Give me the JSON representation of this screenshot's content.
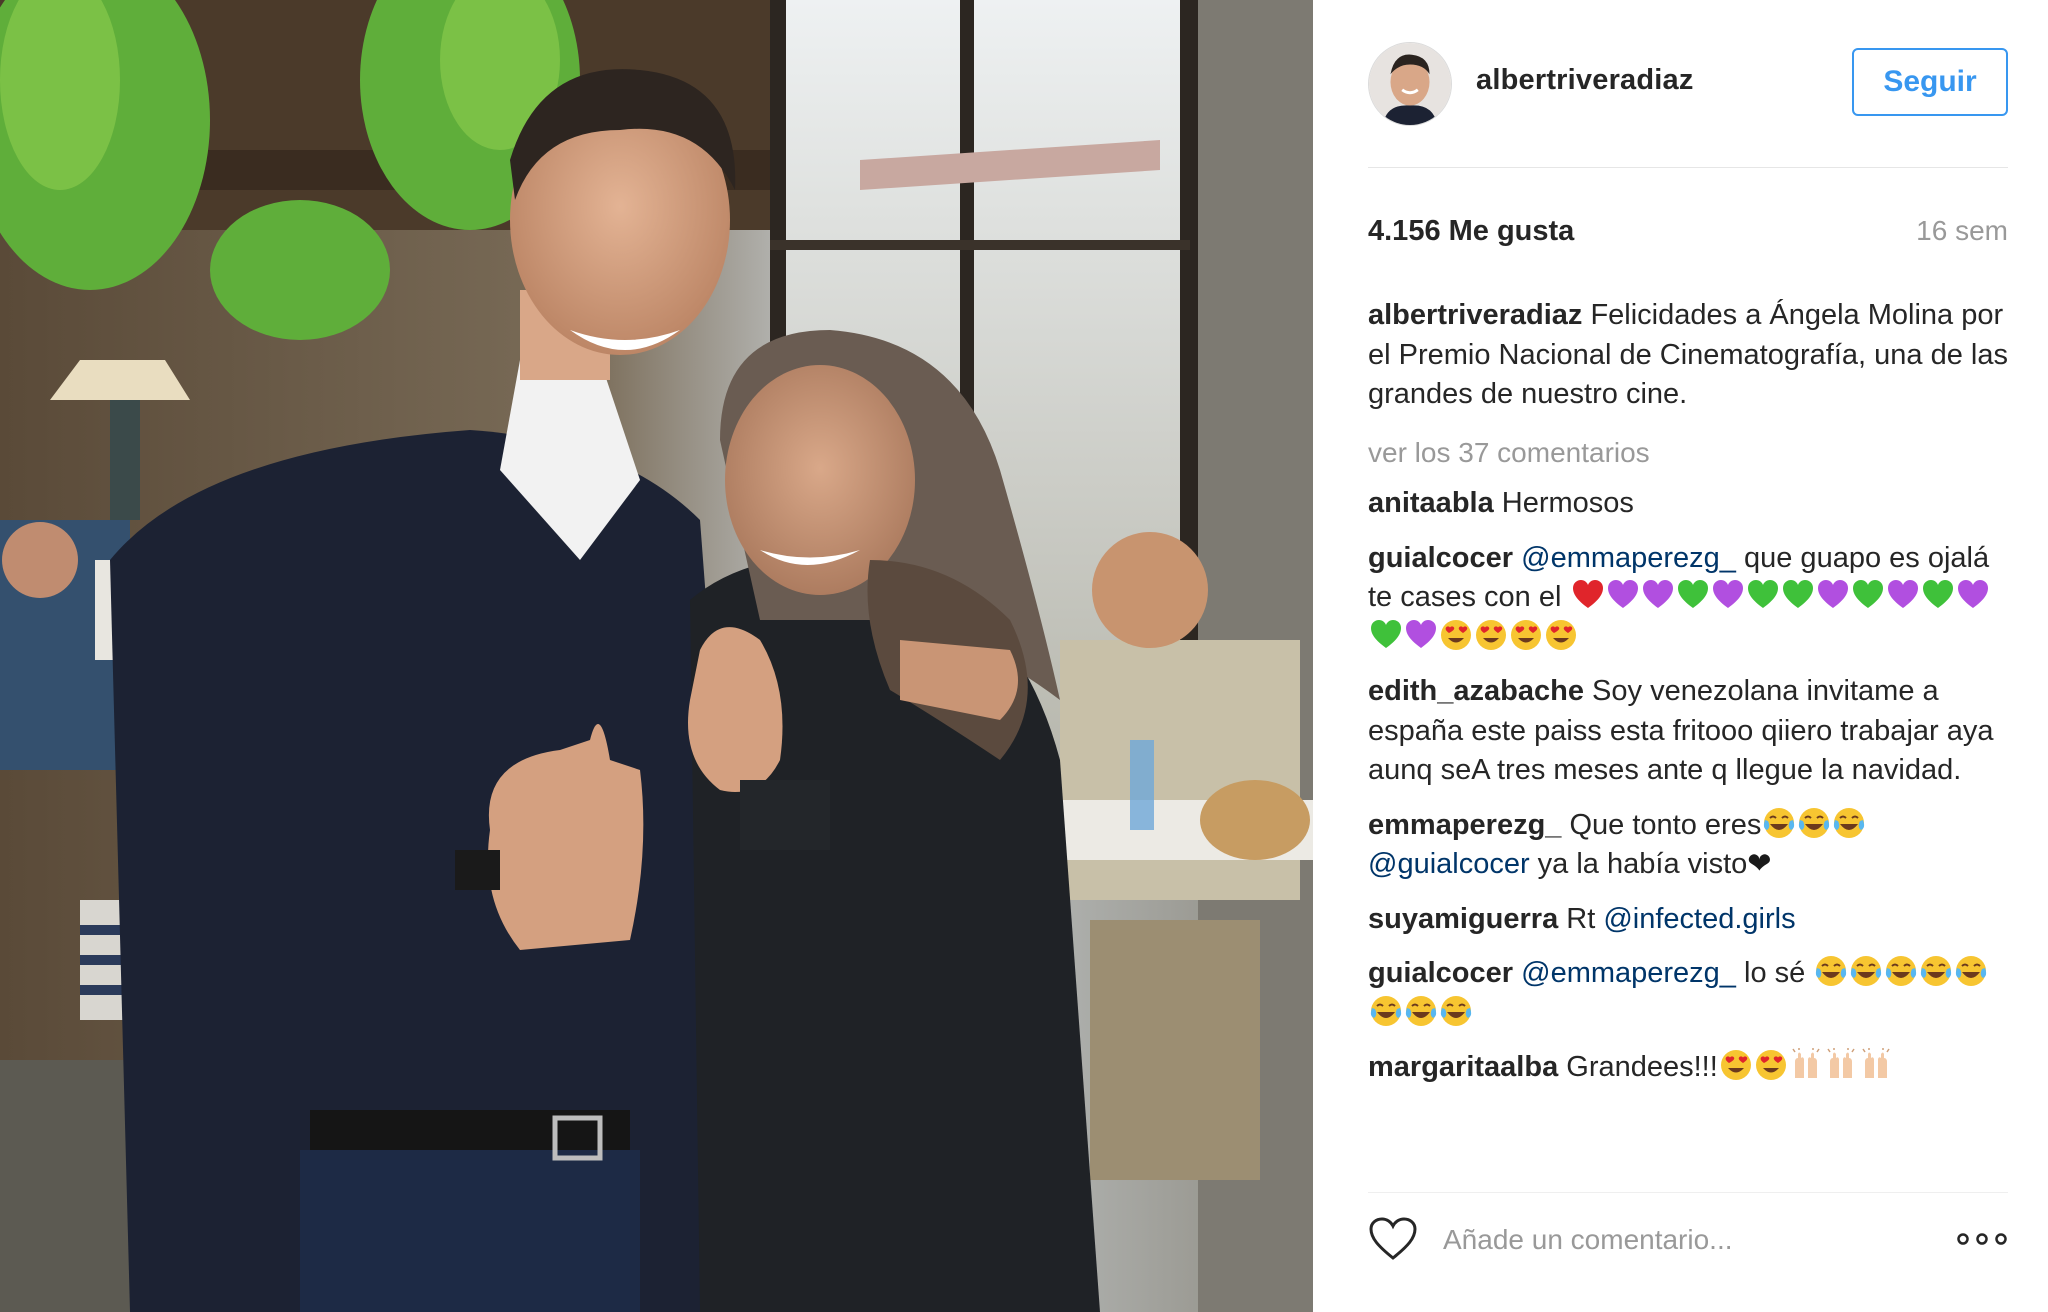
{
  "post": {
    "username": "albertriveradiaz",
    "follow_label": "Seguir",
    "likes": "4.156 Me gusta",
    "age": "16 sem",
    "caption": "Felicidades a Ángela Molina por el Premio Nacional de Cinematografía, una de las grandes de nuestro cine.",
    "view_all": "ver los 37 comentarios"
  },
  "comments": [
    {
      "user": "anitaabla",
      "text": "Hermosos"
    },
    {
      "user": "guialcocer",
      "mention": "@emmaperezg_",
      "text": " que guapo es ojalá te cases con el",
      "emojis": [
        "red-heart",
        "purple-heart",
        "purple-heart",
        "green-heart",
        "purple-heart",
        "green-heart",
        "green-heart",
        "purple-heart",
        "green-heart",
        "purple-heart",
        "green-heart",
        "purple-heart",
        "green-heart",
        "purple-heart",
        "heart-eyes",
        "heart-eyes",
        "heart-eyes",
        "heart-eyes"
      ]
    },
    {
      "user": "edith_azabache",
      "text": "Soy venezolana invitame a españa este paiss esta fritooo qiiero trabajar aya aunq seA tres meses ante q llegue la navidad."
    },
    {
      "user": "emmaperezg_",
      "text": "Que tonto eres",
      "emojis_mid": [
        "tears-of-joy",
        "tears-of-joy",
        "tears-of-joy"
      ],
      "mention": "@guialcocer",
      "text2": " ya la había visto",
      "heart": "❤"
    },
    {
      "user": "suyamiguerra",
      "text": "Rt ",
      "mention": "@infected.girls"
    },
    {
      "user": "guialcocer",
      "mention": "@emmaperezg_",
      "text": " lo sé",
      "emojis": [
        "tears-of-joy",
        "tears-of-joy",
        "tears-of-joy",
        "tears-of-joy",
        "tears-of-joy",
        "tears-of-joy",
        "tears-of-joy",
        "tears-of-joy"
      ]
    },
    {
      "user": "margaritaalba",
      "text": "Grandees!!!",
      "emojis": [
        "heart-eyes",
        "heart-eyes",
        "raising-hands",
        "raising-hands",
        "raising-hands"
      ]
    }
  ],
  "comment_box": {
    "placeholder": "Añade un comentario..."
  },
  "icons": {
    "like": "heart-outline-icon",
    "more": "more-options-icon"
  },
  "colors": {
    "accent": "#3897f0",
    "mention": "#003569",
    "muted": "#999999"
  }
}
